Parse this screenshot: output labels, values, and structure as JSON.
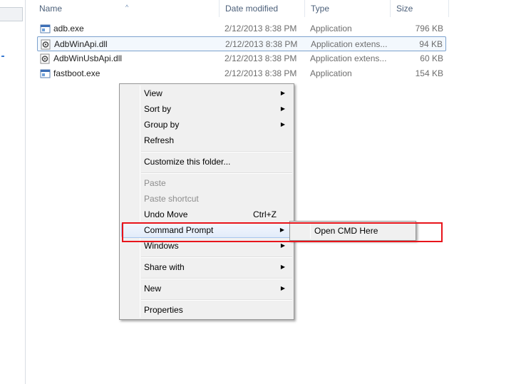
{
  "columns": {
    "name": "Name",
    "date_modified": "Date modified",
    "type": "Type",
    "size": "Size"
  },
  "files": [
    {
      "name": "adb.exe",
      "date": "2/12/2013 8:38 PM",
      "type": "Application",
      "size": "796 KB",
      "icon": "exe-icon"
    },
    {
      "name": "AdbWinApi.dll",
      "date": "2/12/2013 8:38 PM",
      "type": "Application extens...",
      "size": "94 KB",
      "icon": "dll-gear-icon"
    },
    {
      "name": "AdbWinUsbApi.dll",
      "date": "2/12/2013 8:38 PM",
      "type": "Application extens...",
      "size": "60 KB",
      "icon": "dll-gear-icon"
    },
    {
      "name": "fastboot.exe",
      "date": "2/12/2013 8:38 PM",
      "type": "Application",
      "size": "154 KB",
      "icon": "exe-icon"
    }
  ],
  "context_menu": {
    "view": "View",
    "sort_by": "Sort by",
    "group_by": "Group by",
    "refresh": "Refresh",
    "customize": "Customize this folder...",
    "paste": "Paste",
    "paste_shortcut": "Paste shortcut",
    "undo_move": "Undo Move",
    "undo_shortcut": "Ctrl+Z",
    "command_prompt": "Command Prompt",
    "windows": "Windows",
    "share_with": "Share with",
    "new": "New",
    "properties": "Properties",
    "arrow": "▶"
  },
  "submenu": {
    "open_cmd": "Open CMD Here"
  },
  "colors": {
    "highlight_border": "#e8141b",
    "selection": "#7da2ce"
  }
}
